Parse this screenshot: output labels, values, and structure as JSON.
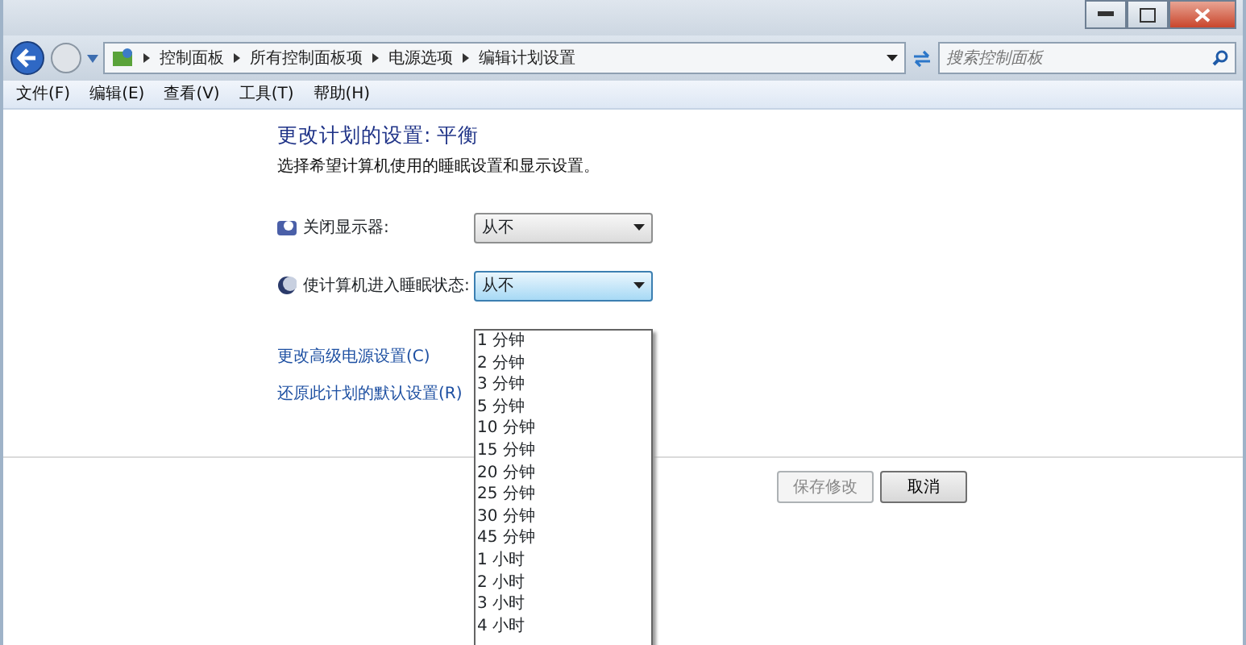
{
  "breadcrumb": [
    "控制面板",
    "所有控制面板项",
    "电源选项",
    "编辑计划设置"
  ],
  "search": {
    "placeholder": "搜索控制面板"
  },
  "menu": [
    "文件(F)",
    "编辑(E)",
    "查看(V)",
    "工具(T)",
    "帮助(H)"
  ],
  "heading": "更改计划的设置: 平衡",
  "subheading": "选择希望计算机使用的睡眠设置和显示设置。",
  "settings": [
    {
      "kind": "display",
      "label": "关闭显示器:",
      "value": "从不",
      "focused": false
    },
    {
      "kind": "sleep",
      "label": "使计算机进入睡眠状态:",
      "value": "从不",
      "focused": true
    }
  ],
  "dropdown_options": [
    "1 分钟",
    "2 分钟",
    "3 分钟",
    "5 分钟",
    "10 分钟",
    "15 分钟",
    "20 分钟",
    "25 分钟",
    "30 分钟",
    "45 分钟",
    "1 小时",
    "2 小时",
    "3 小时",
    "4 小时"
  ],
  "links": [
    "更改高级电源设置(C)",
    "还原此计划的默认设置(R)"
  ],
  "buttons": [
    {
      "label": "保存修改",
      "disabled": true
    },
    {
      "label": "取消",
      "disabled": false
    }
  ]
}
